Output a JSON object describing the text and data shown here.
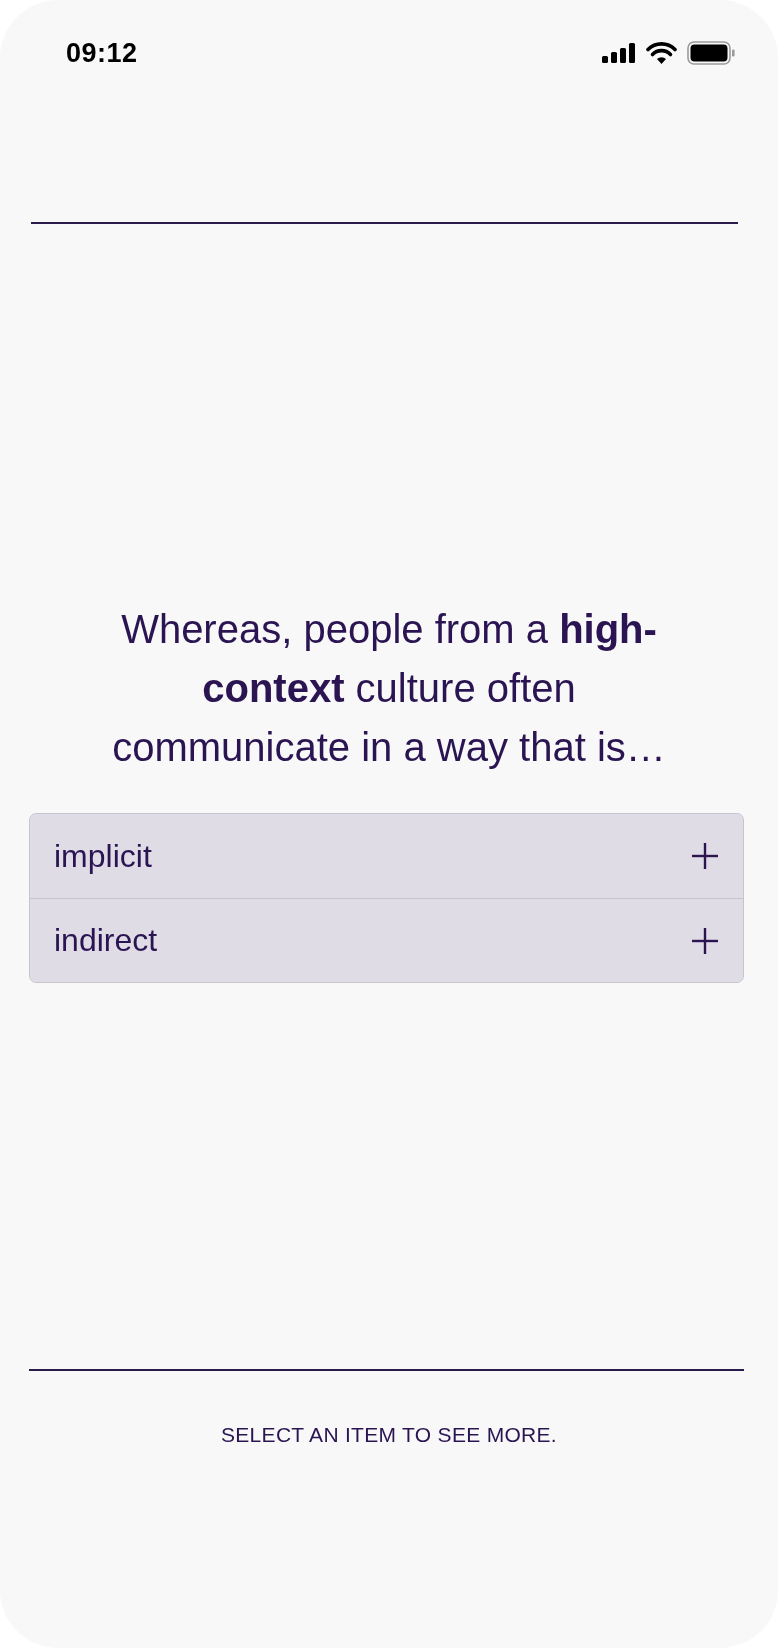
{
  "status_bar": {
    "time": "09:12"
  },
  "question": "Whereas, people from a **high-context** culture often communicate in a way that is…",
  "options": [
    {
      "label": "implicit",
      "expanded": false
    },
    {
      "label": "indirect",
      "expanded": false
    }
  ],
  "footer": {
    "hint": "SELECT AN ITEM TO SEE MORE."
  }
}
